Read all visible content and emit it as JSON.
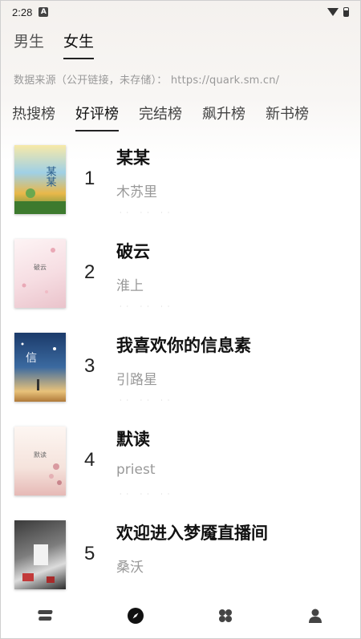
{
  "status_bar": {
    "time": "2:28",
    "notification_glyph": "A"
  },
  "gender_tabs": [
    {
      "label": "男生",
      "active": false
    },
    {
      "label": "女生",
      "active": true
    }
  ],
  "source_text": "数据来源（公开链接，未存储）： https://quark.sm.cn/",
  "rank_tabs": [
    {
      "label": "热搜榜",
      "active": false
    },
    {
      "label": "好评榜",
      "active": true
    },
    {
      "label": "完结榜",
      "active": false
    },
    {
      "label": "飙升榜",
      "active": false
    },
    {
      "label": "新书榜",
      "active": false
    }
  ],
  "books": [
    {
      "rank": "1",
      "title": "某某",
      "author": "木苏里",
      "cover_colors": [
        "#f7e9a8",
        "#7bbbe0",
        "#4a8a3a"
      ]
    },
    {
      "rank": "2",
      "title": "破云",
      "author": "淮上",
      "cover_text": "破云",
      "cover_colors": [
        "#fbeff0",
        "#f3d2d8",
        "#e8b9c3"
      ]
    },
    {
      "rank": "3",
      "title": "我喜欢你的信息素",
      "author": "引路星",
      "cover_colors": [
        "#1b3a6a",
        "#4c7fb6",
        "#e8c27a"
      ]
    },
    {
      "rank": "4",
      "title": "默读",
      "author": "priest",
      "cover_text": "默读",
      "cover_colors": [
        "#fbf2ee",
        "#f2d9d3",
        "#d79fa0"
      ]
    },
    {
      "rank": "5",
      "title": "欢迎进入梦魇直播间",
      "author": "桑沃",
      "cover_colors": [
        "#2a2a2a",
        "#8a8a8a",
        "#c23a3a"
      ]
    }
  ],
  "bottom_nav": [
    {
      "icon": "bookshelf-icon",
      "active": false
    },
    {
      "icon": "compass-icon",
      "active": true
    },
    {
      "icon": "categories-icon",
      "active": false
    },
    {
      "icon": "profile-icon",
      "active": false
    }
  ]
}
